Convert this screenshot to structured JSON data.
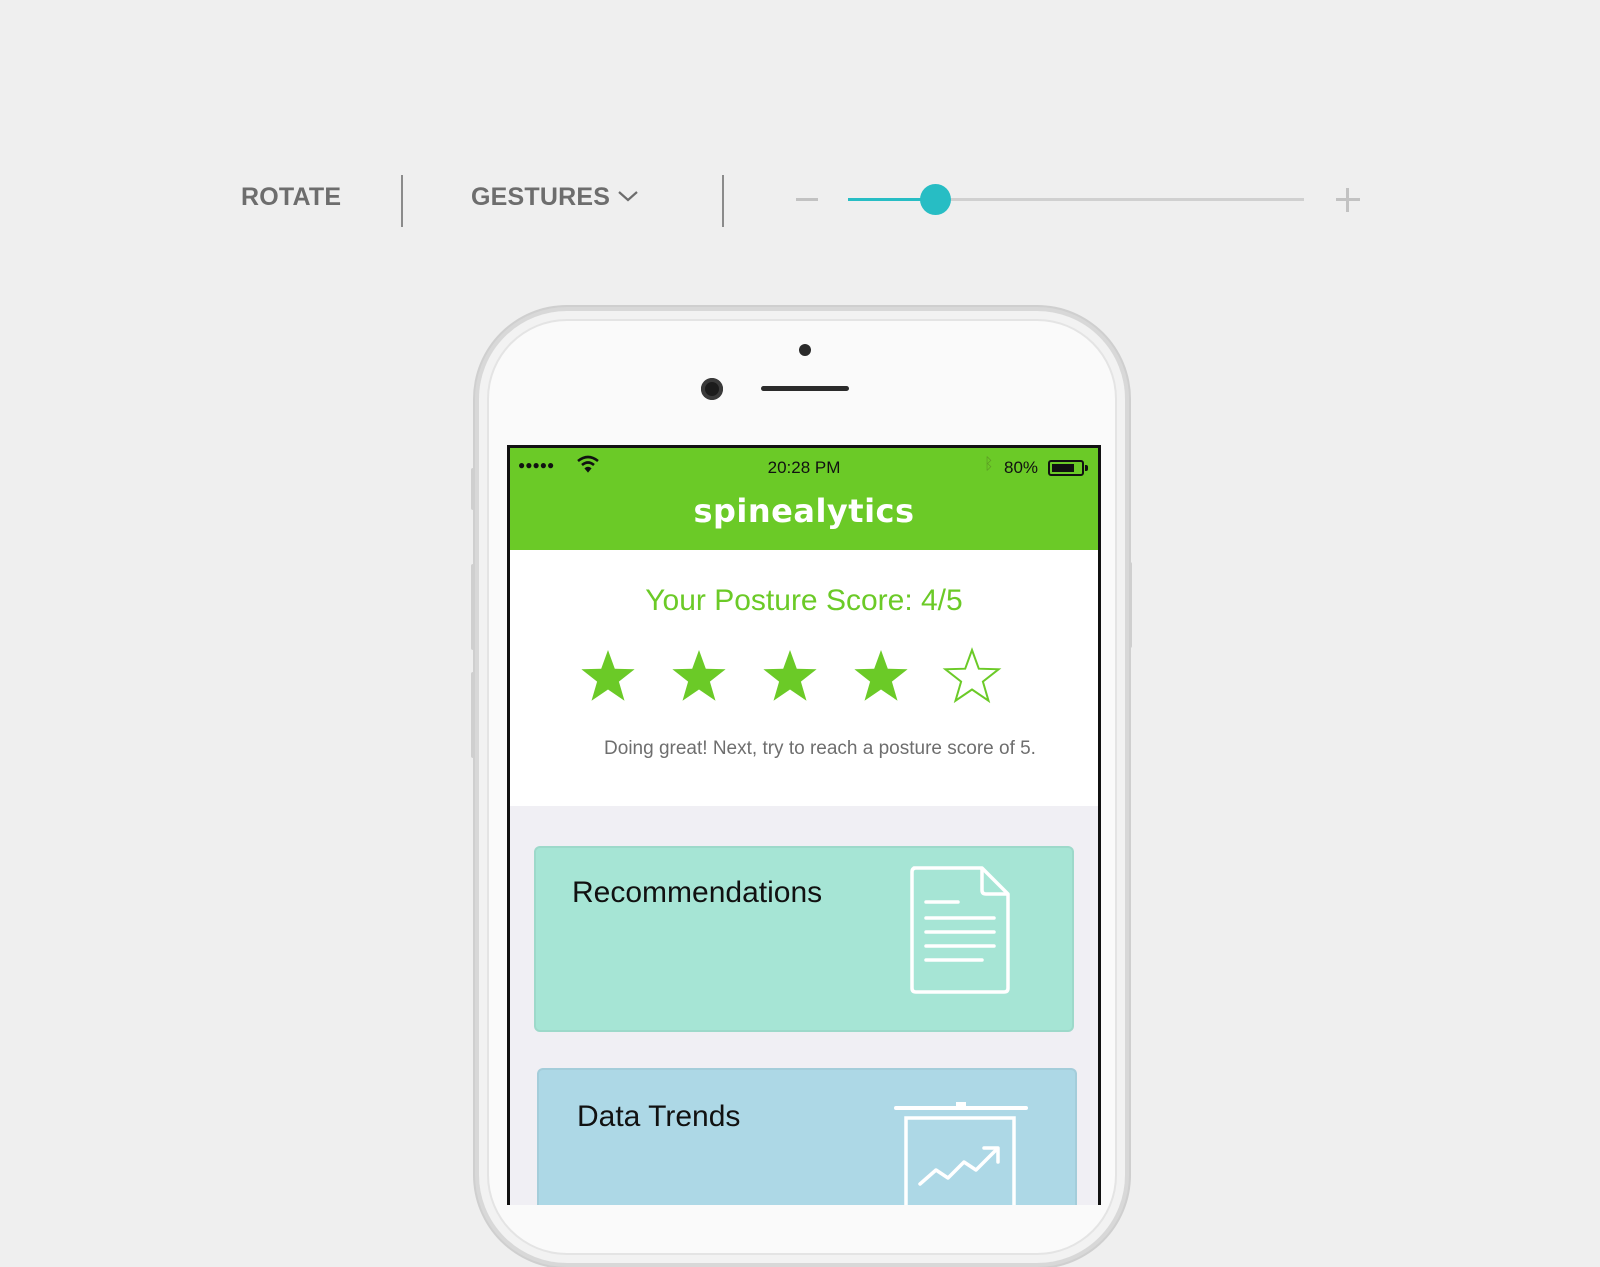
{
  "toolbar": {
    "rotate_label": "ROTATE",
    "gestures_label": "GESTURES",
    "zoom": {
      "level_fraction": 0.19,
      "accent_color": "#27bdc4"
    }
  },
  "status_bar": {
    "signal": "●●●●●",
    "time": "20:28 PM",
    "bluetooth": "ᛒ",
    "battery": "80%",
    "battery_level": 0.8
  },
  "app": {
    "title": "spinealytics",
    "brand_color": "#6bca27"
  },
  "posture": {
    "title": "Your Posture Score: 4/5",
    "score": 4,
    "max": 5,
    "message": "Doing great! Next, try to reach a posture score of 5."
  },
  "cards": [
    {
      "label": "Recommendations",
      "icon": "document-icon",
      "color": "#a6e5d5"
    },
    {
      "label": "Data Trends",
      "icon": "trend-chart-icon",
      "color": "#add8e6"
    }
  ]
}
